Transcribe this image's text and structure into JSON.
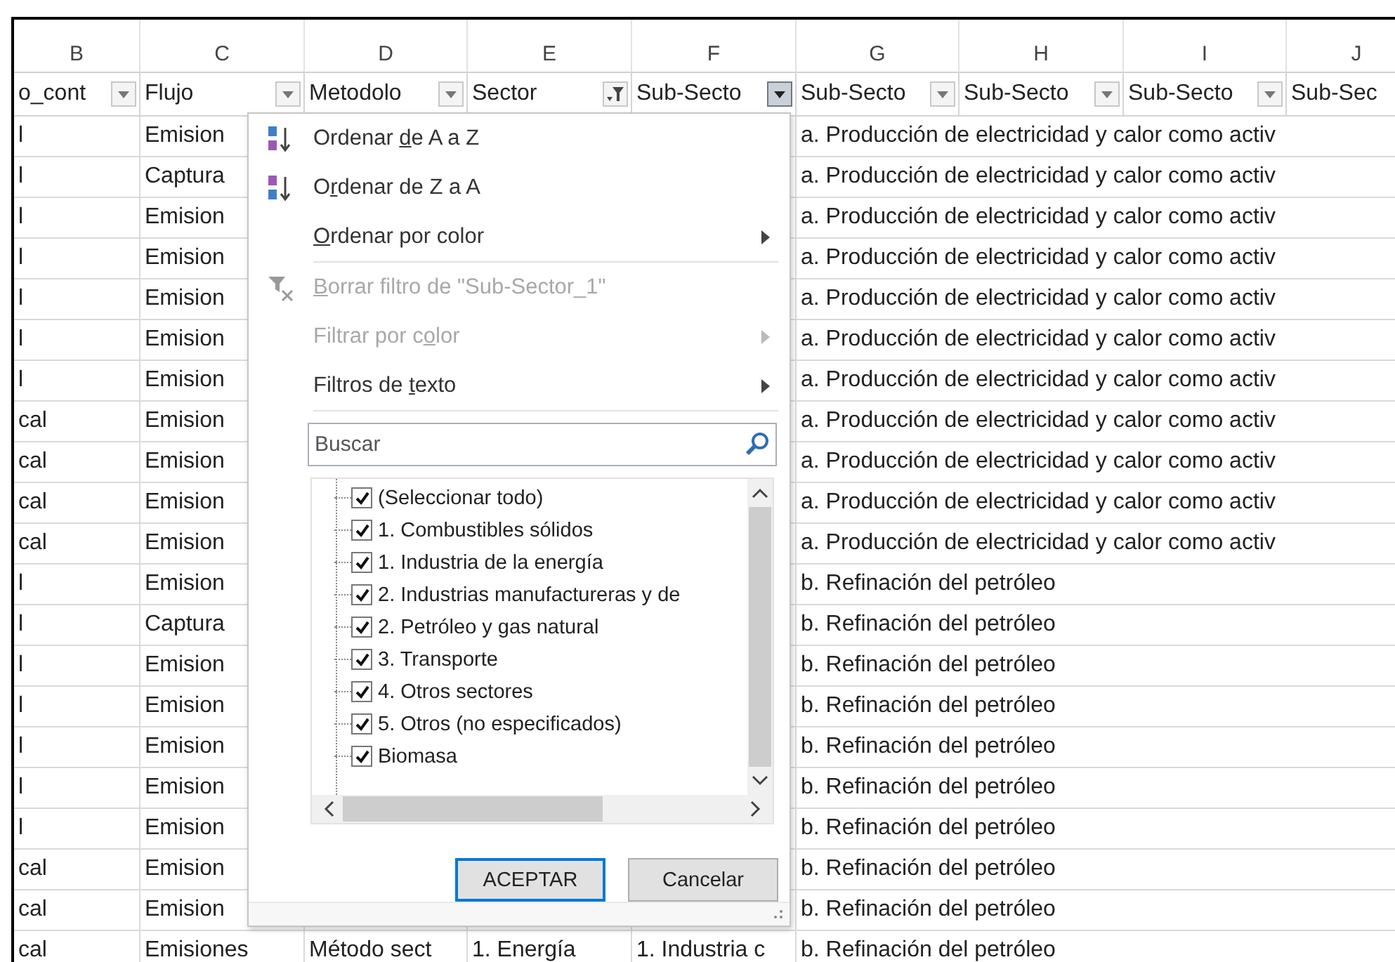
{
  "columns": [
    {
      "letter": "B",
      "header": "o_cont",
      "kind": "dropdown",
      "open": false
    },
    {
      "letter": "C",
      "header": "Flujo",
      "kind": "dropdown",
      "open": false
    },
    {
      "letter": "D",
      "header": "Metodolo",
      "kind": "dropdown",
      "open": false
    },
    {
      "letter": "E",
      "header": "Sector",
      "kind": "filtered",
      "open": false
    },
    {
      "letter": "F",
      "header": "Sub-Secto",
      "kind": "dropdown",
      "open": true
    },
    {
      "letter": "G",
      "header": "Sub-Secto",
      "kind": "dropdown",
      "open": false
    },
    {
      "letter": "H",
      "header": "Sub-Secto",
      "kind": "dropdown",
      "open": false
    },
    {
      "letter": "I",
      "header": "Sub-Secto",
      "kind": "dropdown",
      "open": false
    },
    {
      "letter": "J",
      "header": "Sub-Sec",
      "kind": "none"
    }
  ],
  "rows": [
    {
      "b": "l",
      "c": "Emision",
      "g": "a. Producción de electricidad y calor como activ"
    },
    {
      "b": "l",
      "c": "Captura",
      "g": "a. Producción de electricidad y calor como activ"
    },
    {
      "b": "l",
      "c": "Emision",
      "g": "a. Producción de electricidad y calor como activ"
    },
    {
      "b": "l",
      "c": "Emision",
      "g": "a. Producción de electricidad y calor como activ"
    },
    {
      "b": "l",
      "c": "Emision",
      "g": "a. Producción de electricidad y calor como activ"
    },
    {
      "b": "l",
      "c": "Emision",
      "g": "a. Producción de electricidad y calor como activ"
    },
    {
      "b": "l",
      "c": "Emision",
      "g": "a. Producción de electricidad y calor como activ"
    },
    {
      "b": "cal",
      "c": "Emision",
      "g": "a. Producción de electricidad y calor como activ"
    },
    {
      "b": "cal",
      "c": "Emision",
      "g": "a. Producción de electricidad y calor como activ"
    },
    {
      "b": "cal",
      "c": "Emision",
      "g": "a. Producción de electricidad y calor como activ"
    },
    {
      "b": "cal",
      "c": "Emision",
      "g": "a. Producción de electricidad y calor como activ"
    },
    {
      "b": "l",
      "c": "Emision",
      "g": "b. Refinación del petróleo"
    },
    {
      "b": "l",
      "c": "Captura",
      "g": "b. Refinación del petróleo"
    },
    {
      "b": "l",
      "c": "Emision",
      "g": "b. Refinación del petróleo"
    },
    {
      "b": "l",
      "c": "Emision",
      "g": "b. Refinación del petróleo"
    },
    {
      "b": "l",
      "c": "Emision",
      "g": "b. Refinación del petróleo"
    },
    {
      "b": "l",
      "c": "Emision",
      "g": "b. Refinación del petróleo"
    },
    {
      "b": "l",
      "c": "Emision",
      "g": "b. Refinación del petróleo"
    },
    {
      "b": "cal",
      "c": "Emision",
      "g": "b. Refinación del petróleo"
    },
    {
      "b": "cal",
      "c": "Emision",
      "g": "b. Refinación del petróleo"
    },
    {
      "b": "cal",
      "c": "Emisiones",
      "d": "Método sect",
      "e": "1. Energía",
      "f": "1. Industria c",
      "g": "b. Refinación del petróleo"
    }
  ],
  "filter_menu": {
    "items": [
      {
        "kind": "sort_az",
        "pre": "Ordenar ",
        "key": "d",
        "post": "e A a Z",
        "disabled": false,
        "submenu": false
      },
      {
        "kind": "sort_za",
        "pre": "O",
        "key": "r",
        "post": "denar de Z a A",
        "disabled": false,
        "submenu": false
      },
      {
        "kind": "plain",
        "key": "O",
        "post": "rdenar por color",
        "disabled": false,
        "submenu": true
      },
      {
        "kind": "separator"
      },
      {
        "kind": "clear_filter",
        "key": "B",
        "post": "orrar filtro de \"Sub-Sector_1\"",
        "disabled": true,
        "submenu": false
      },
      {
        "kind": "plain",
        "pre": "Filtrar por c",
        "key": "o",
        "post": "lor",
        "disabled": true,
        "submenu": true
      },
      {
        "kind": "plain",
        "pre": "Filtros de ",
        "key": "t",
        "post": "exto",
        "disabled": false,
        "submenu": true
      },
      {
        "kind": "separator"
      }
    ],
    "search": {
      "placeholder": "Buscar"
    },
    "values": [
      {
        "label": "(Seleccionar todo)",
        "checked": true
      },
      {
        "label": "1. Combustibles sólidos",
        "checked": true
      },
      {
        "label": "1. Industria de la energía",
        "checked": true
      },
      {
        "label": "2. Industrias manufactureras y de",
        "checked": true
      },
      {
        "label": "2. Petróleo y gas natural",
        "checked": true
      },
      {
        "label": "3. Transporte",
        "checked": true
      },
      {
        "label": "4. Otros sectores",
        "checked": true
      },
      {
        "label": "5. Otros (no especificados)",
        "checked": true
      },
      {
        "label": "Biomasa",
        "checked": true
      }
    ],
    "buttons": [
      {
        "label": "ACEPTAR",
        "default": true
      },
      {
        "label": "Cancelar",
        "default": false
      }
    ]
  }
}
